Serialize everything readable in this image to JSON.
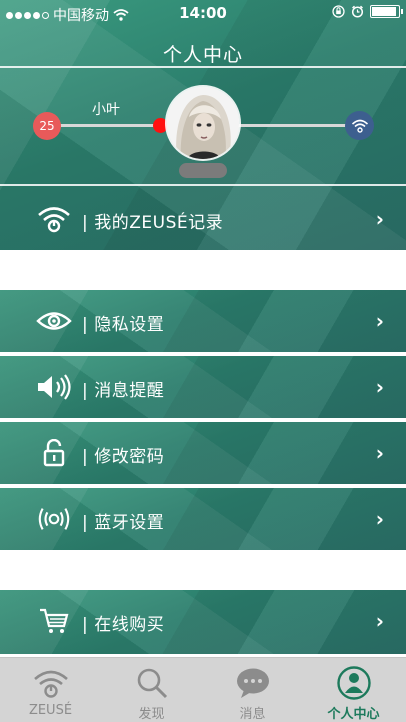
{
  "status_bar": {
    "carrier": "中国移动",
    "time": "14:00"
  },
  "header": {
    "title": "个人中心",
    "user_name": "小叶",
    "age": "25"
  },
  "menu": [
    {
      "label": "我的ZEUSÉ记录",
      "icon": "zeuse-wifi-icon"
    },
    {
      "label": "隐私设置",
      "icon": "eye-icon"
    },
    {
      "label": "消息提醒",
      "icon": "speaker-icon"
    },
    {
      "label": "修改密码",
      "icon": "unlock-icon"
    },
    {
      "label": "蓝牙设置",
      "icon": "bluetooth-wave-icon"
    },
    {
      "label": "在线购买",
      "icon": "shopping-cart-icon"
    }
  ],
  "tabs": [
    {
      "label": "ZEUSÉ",
      "icon": "zeuse-wifi-icon"
    },
    {
      "label": "发现",
      "icon": "search-icon"
    },
    {
      "label": "消息",
      "icon": "chat-bubble-icon"
    },
    {
      "label": "个人中心",
      "icon": "person-icon",
      "active": true
    }
  ],
  "colors": {
    "accent": "#1d7a5c",
    "age_badge": "#e85a5a",
    "device_badge": "#3d5f8f",
    "tab_bar": "#d4d4d4"
  }
}
